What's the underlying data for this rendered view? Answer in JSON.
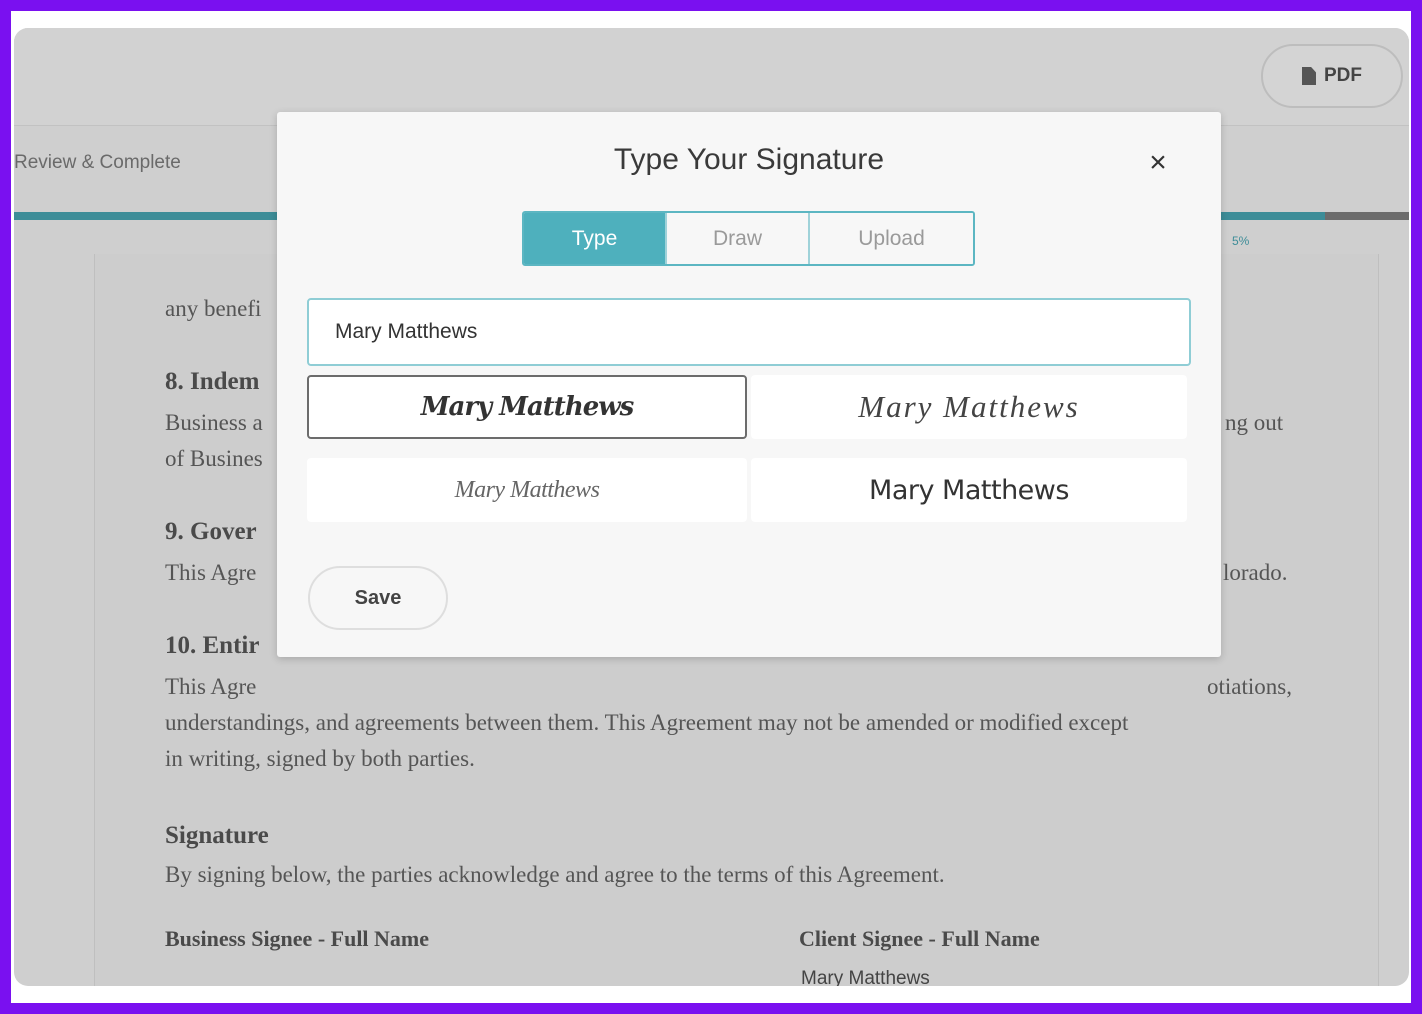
{
  "toolbar": {
    "pdf_label": "PDF"
  },
  "stepper": {
    "step_label": "Review & Complete",
    "progress_percent": 94,
    "progress_text": "5%"
  },
  "document": {
    "lines": [
      "any benefi",
      "8. Indem",
      "Business a",
      "ng out",
      "of Busines",
      "9. Gover",
      "This Agre",
      "lorado.",
      "10. Entir",
      "This Agre",
      "otiations,",
      "understandings, and agreements between them. This Agreement may not be amended or modified except",
      "in writing, signed by both parties."
    ],
    "signature_heading": "Signature",
    "signature_intro": "By signing below, the parties acknowledge and agree to the terms of this Agreement.",
    "business_label": "Business Signee - Full Name",
    "client_label": "Client Signee - Full Name",
    "client_name": "Mary Matthews"
  },
  "modal": {
    "title": "Type Your Signature",
    "close_glyph": "×",
    "tabs": [
      {
        "label": "Type",
        "active": true
      },
      {
        "label": "Draw",
        "active": false
      },
      {
        "label": "Upload",
        "active": false
      }
    ],
    "input_value": "Mary Matthews",
    "signature_options": [
      "Mary Matthews",
      "Mary Matthews",
      "Mary Matthews",
      "Mary Matthews"
    ],
    "selected_option": 0,
    "save_label": "Save"
  },
  "colors": {
    "accent": "#4eb0bd",
    "frame": "#7a10f0"
  }
}
